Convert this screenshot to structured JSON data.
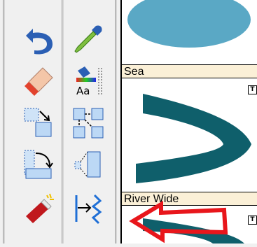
{
  "tools": [
    {
      "name": "undo-icon"
    },
    {
      "name": "eyedropper-icon"
    },
    {
      "name": "eraser-icon"
    },
    {
      "name": "text-color-icon"
    },
    {
      "name": "resize-icon"
    },
    {
      "name": "connect-icon"
    },
    {
      "name": "rotate-icon"
    },
    {
      "name": "perspective-icon"
    },
    {
      "name": "magic-wand-icon"
    },
    {
      "name": "line-end-icon"
    }
  ],
  "text_color_tool": {
    "glyph": "Aa"
  },
  "library": {
    "items": [
      {
        "caption": "",
        "color": "#5aa8c5"
      },
      {
        "caption": "Sea",
        "color": "#5aa8c5",
        "badge": "T"
      },
      {
        "caption": "River Wide",
        "color": "#0f5f6b",
        "badge": "T"
      }
    ]
  },
  "annotation": {
    "color": "#e8161b",
    "shape": "arrow-outline-pointing-left"
  }
}
